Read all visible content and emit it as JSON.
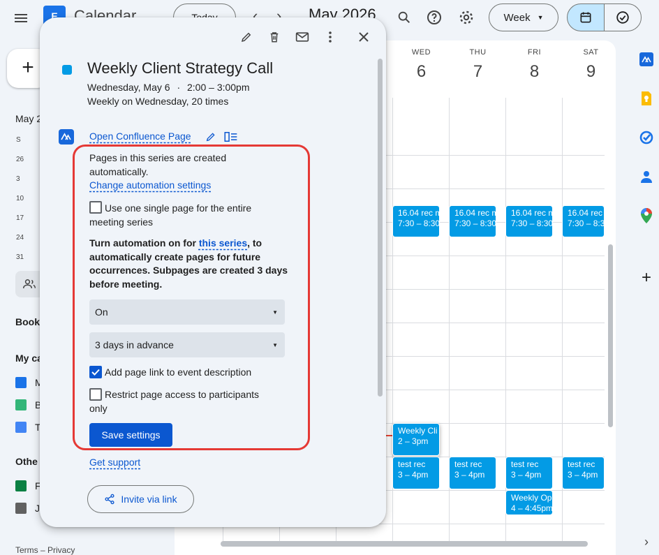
{
  "header": {
    "app_title": "Calendar",
    "logo_letter": "E",
    "today_label": "Today",
    "prev_glyph": "‹",
    "next_glyph": "›",
    "month_label": "May 2026",
    "view_label": "Week",
    "icons": [
      "menu-icon",
      "search-icon",
      "help-icon",
      "gear-icon",
      "calendar-view-icon",
      "tasks-view-icon"
    ]
  },
  "sidebar": {
    "create_glyph": "+",
    "mini_month": "May 2",
    "mini_day_initial": "S",
    "mini_dates": [
      "26",
      "3",
      "10",
      "17",
      "24",
      "31"
    ],
    "booking": "Booki",
    "my_cal": "My ca",
    "my_cals": [
      {
        "letter": "M",
        "color": "#1a73e8"
      },
      {
        "letter": "B",
        "color": "#33b679"
      },
      {
        "letter": "T",
        "color": "#4285f4"
      }
    ],
    "other_cal": "Othe",
    "other_cals": [
      {
        "letter": "F",
        "color": "#0b8043"
      },
      {
        "letter": "J",
        "color": "#616161"
      }
    ],
    "footer": "Terms – Privacy"
  },
  "grid": {
    "days": [
      {
        "name": "WED",
        "num": "6"
      },
      {
        "name": "THU",
        "num": "7"
      },
      {
        "name": "FRI",
        "num": "8"
      },
      {
        "name": "SAT",
        "num": "9"
      }
    ],
    "events_morning": [
      {
        "title": "16.04 rec m",
        "time": "7:30 – 8:30"
      },
      {
        "title": "16.04 rec m",
        "time": "7:30 – 8:30"
      },
      {
        "title": "16.04 rec m",
        "time": "7:30 – 8:30"
      },
      {
        "title": "16.04 rec m",
        "time": "7:30 – 8:30"
      }
    ],
    "event_weekly": {
      "title": "Weekly Cli",
      "time": "2 – 3pm"
    },
    "events_test": [
      {
        "title": "test rec",
        "time": "3 – 4pm"
      },
      {
        "title": "test rec",
        "time": "3 – 4pm"
      },
      {
        "title": "test rec",
        "time": "3 – 4pm"
      },
      {
        "title": "test rec",
        "time": "3 – 4pm"
      }
    ],
    "event_weekly_op": {
      "title": "Weekly Op",
      "time": "4 – 4:45pm"
    },
    "event_color": "#039be5"
  },
  "popup": {
    "toolbar_icons": [
      "edit-icon",
      "delete-icon",
      "email-icon",
      "more-icon",
      "close-icon"
    ],
    "event_title": "Weekly Client Strategy Call",
    "event_date": "Wednesday, May 6",
    "event_sep": "·",
    "event_time": "2:00 – 3:00pm",
    "event_recurrence": "Weekly on Wednesday, 20 times",
    "confluence_link": "Open Confluence Page",
    "auto_text": "Pages in this series are created automatically.",
    "change_link": "Change automation settings",
    "single_page_label": "Use one single page for the entire meeting series",
    "single_page_checked": false,
    "bold_prefix": "Turn automation on for ",
    "bold_link": "this series",
    "bold_suffix": ", to automatically create pages for future occurrences. Subpages are created 3 days before meeting.",
    "select_status": "On",
    "select_days": "3 days in advance",
    "add_link_label": "Add page link to event description",
    "add_link_checked": true,
    "restrict_label": "Restrict page access to participants only",
    "restrict_checked": false,
    "save_label": "Save settings",
    "support_link": "Get support",
    "invite_label": "Invite via link",
    "highlight_color": "#e53935"
  }
}
